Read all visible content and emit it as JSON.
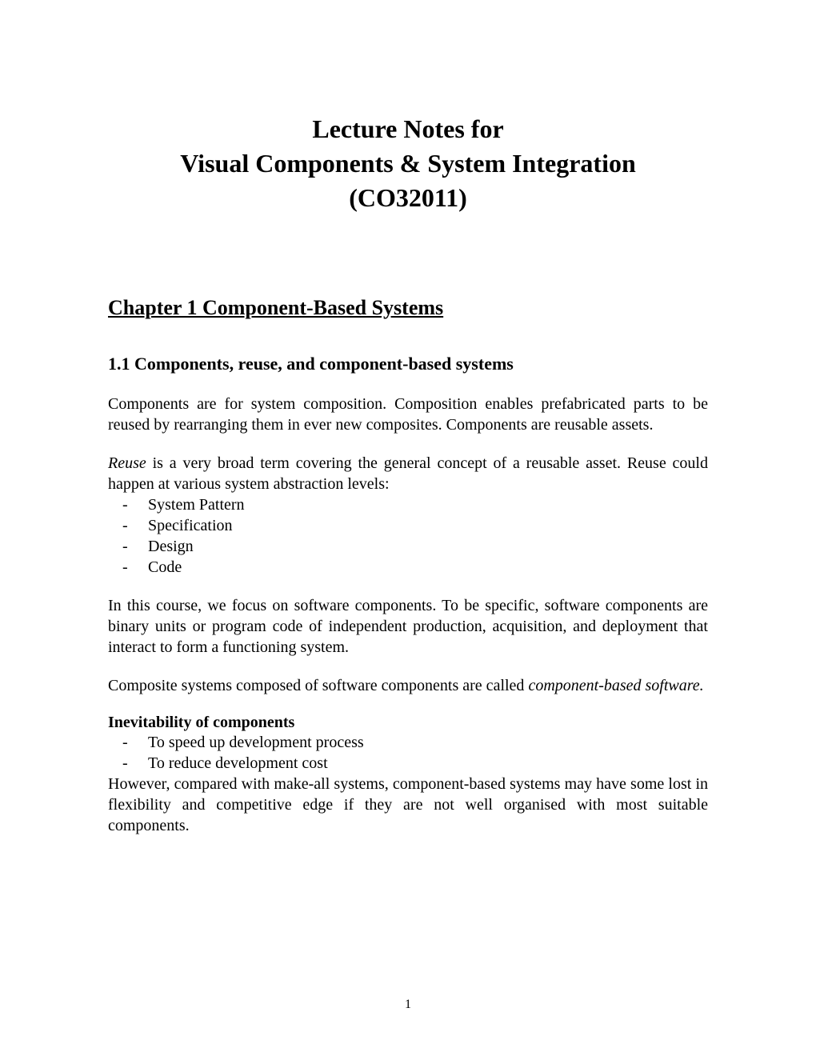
{
  "title": {
    "line1": "Lecture Notes for",
    "line2": "Visual Components & System Integration",
    "line3": "(CO32011)"
  },
  "chapter": "Chapter 1 Component-Based Systems",
  "section": "1.1 Components, reuse, and component-based systems",
  "para1": "Components are for system composition. Composition enables prefabricated parts to be reused by rearranging them in ever new composites. Components are reusable assets.",
  "para2_italic": "Reuse",
  "para2_rest": " is a very broad term covering the general concept of a reusable asset. Reuse could happen at various system abstraction levels:",
  "list1": [
    "System Pattern",
    "Specification",
    "Design",
    "Code"
  ],
  "para3": "In this course, we focus on software components. To be specific, software components are binary units or program code of independent production, acquisition, and deployment that interact to form a functioning system.",
  "para4_a": "Composite systems composed of software components are called ",
  "para4_italic": "component-based software.",
  "subhead1": "Inevitability of components",
  "list2": [
    "To speed up development process",
    "To reduce development cost"
  ],
  "para5": "However, compared with make-all systems, component-based systems may have some lost in flexibility and competitive edge if they are not well organised with most suitable components.",
  "page_number": "1"
}
